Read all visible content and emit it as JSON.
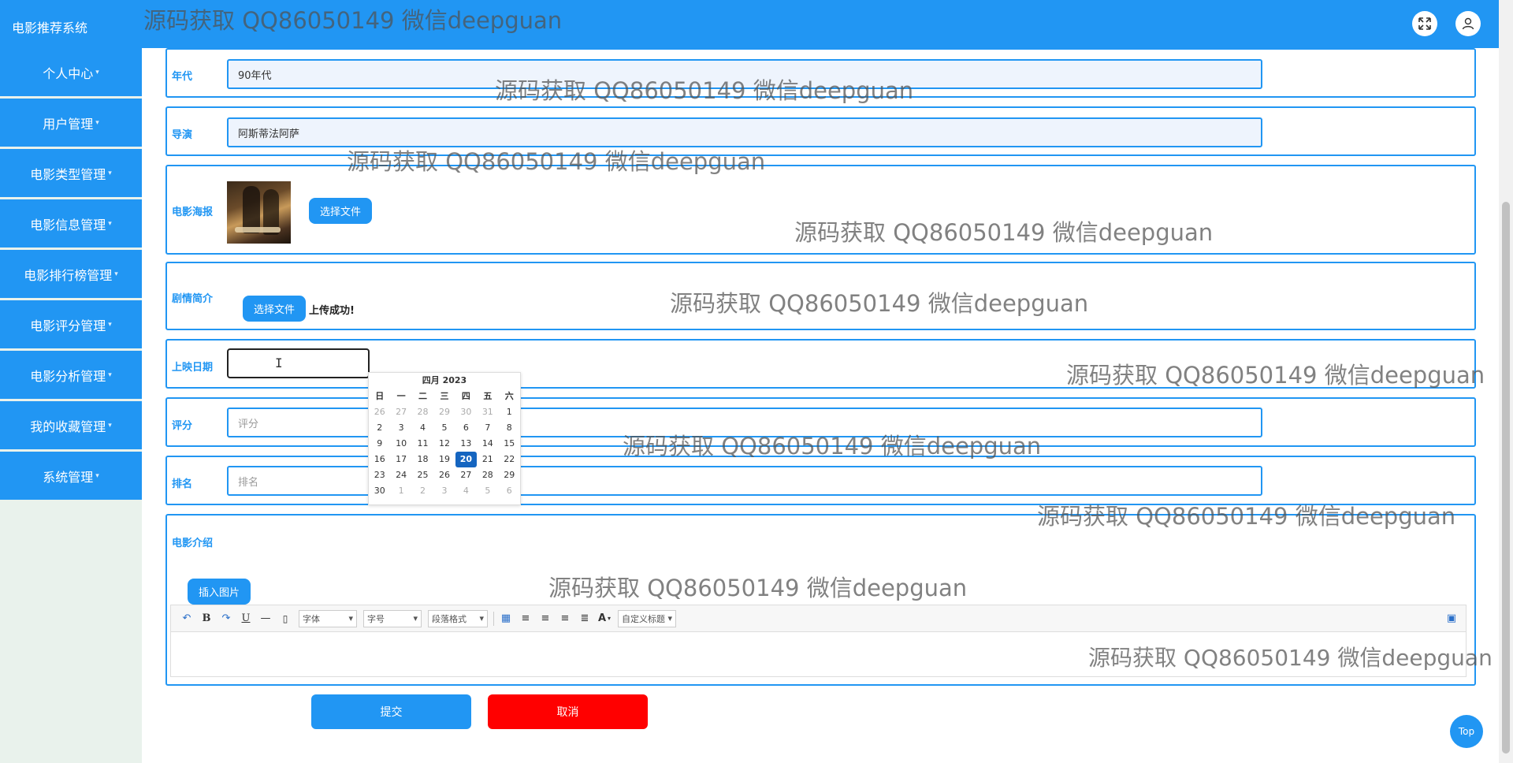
{
  "header": {
    "brand": "电影推荐系统"
  },
  "sidebar": {
    "items": [
      {
        "label": "个人中心"
      },
      {
        "label": "用户管理"
      },
      {
        "label": "电影类型管理"
      },
      {
        "label": "电影信息管理"
      },
      {
        "label": "电影排行榜管理"
      },
      {
        "label": "电影评分管理"
      },
      {
        "label": "电影分析管理"
      },
      {
        "label": "我的收藏管理"
      },
      {
        "label": "系统管理"
      }
    ]
  },
  "form": {
    "era": {
      "label": "年代",
      "value": "90年代"
    },
    "director": {
      "label": "导演",
      "value": "阿斯蒂法阿萨"
    },
    "poster": {
      "label": "电影海报",
      "button": "选择文件"
    },
    "synopsis": {
      "label": "剧情简介",
      "button": "选择文件",
      "status": "上传成功!"
    },
    "release_date": {
      "label": "上映日期",
      "value": ""
    },
    "rating": {
      "label": "评分",
      "placeholder": "评分"
    },
    "rank": {
      "label": "排名",
      "placeholder": "排名"
    },
    "intro": {
      "label": "电影介绍",
      "insert_image": "插入图片"
    }
  },
  "datepicker": {
    "title": "四月 2023",
    "weekdays": [
      "日",
      "一",
      "二",
      "三",
      "四",
      "五",
      "六"
    ],
    "weeks": [
      [
        "26",
        "27",
        "28",
        "29",
        "30",
        "31",
        "1"
      ],
      [
        "2",
        "3",
        "4",
        "5",
        "6",
        "7",
        "8"
      ],
      [
        "9",
        "10",
        "11",
        "12",
        "13",
        "14",
        "15"
      ],
      [
        "16",
        "17",
        "18",
        "19",
        "20",
        "21",
        "22"
      ],
      [
        "23",
        "24",
        "25",
        "26",
        "27",
        "28",
        "29"
      ],
      [
        "30",
        "1",
        "2",
        "3",
        "4",
        "5",
        "6"
      ]
    ],
    "today": "20"
  },
  "editor_toolbar": {
    "font": "字体",
    "size": "字号",
    "paragraph": "段落格式",
    "custom_title": "自定义标题"
  },
  "actions": {
    "submit": "提交",
    "cancel": "取消",
    "top": "Top"
  },
  "watermark": "源码获取 QQ86050149 微信deepguan"
}
